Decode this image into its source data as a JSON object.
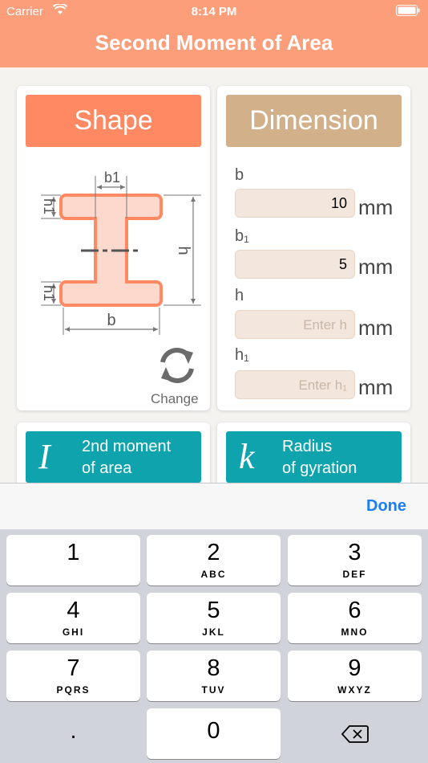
{
  "status_bar": {
    "carrier": "Carrier",
    "time": "8:14 PM"
  },
  "header": {
    "title": "Second Moment of Area"
  },
  "shape_card": {
    "button_label": "Shape",
    "change_label": "Change",
    "diagram_labels": {
      "b1": "b1",
      "h1_top": "h1",
      "h": "h",
      "h1_bottom": "h1",
      "b": "b"
    }
  },
  "dimension_card": {
    "button_label": "Dimension",
    "fields": [
      {
        "label": "b",
        "value": "10",
        "placeholder": "",
        "unit": "mm"
      },
      {
        "label": "b₁",
        "value": "5",
        "placeholder": "",
        "unit": "mm"
      },
      {
        "label": "h",
        "value": "",
        "placeholder": "Enter h",
        "unit": "mm"
      },
      {
        "label": "h₁",
        "value": "",
        "placeholder": "Enter h₁",
        "unit": "mm"
      }
    ]
  },
  "results": [
    {
      "symbol": "I",
      "line1": "2nd moment",
      "line2": "of area"
    },
    {
      "symbol": "k",
      "line1": "Radius",
      "line2": "of gyration"
    }
  ],
  "keyboard": {
    "done_label": "Done",
    "keys": [
      {
        "num": "1",
        "letters": ""
      },
      {
        "num": "2",
        "letters": "ABC"
      },
      {
        "num": "3",
        "letters": "DEF"
      },
      {
        "num": "4",
        "letters": "GHI"
      },
      {
        "num": "5",
        "letters": "JKL"
      },
      {
        "num": "6",
        "letters": "MNO"
      },
      {
        "num": "7",
        "letters": "PQRS"
      },
      {
        "num": "8",
        "letters": "TUV"
      },
      {
        "num": "9",
        "letters": "WXYZ"
      },
      {
        "num": ".",
        "letters": ""
      },
      {
        "num": "0",
        "letters": ""
      }
    ]
  },
  "colors": {
    "header": "#fd9e7b",
    "shape_button": "#ff8962",
    "dimension_button": "#d2b08a",
    "result_button": "#0fa3ad",
    "done": "#1a7ef5"
  }
}
